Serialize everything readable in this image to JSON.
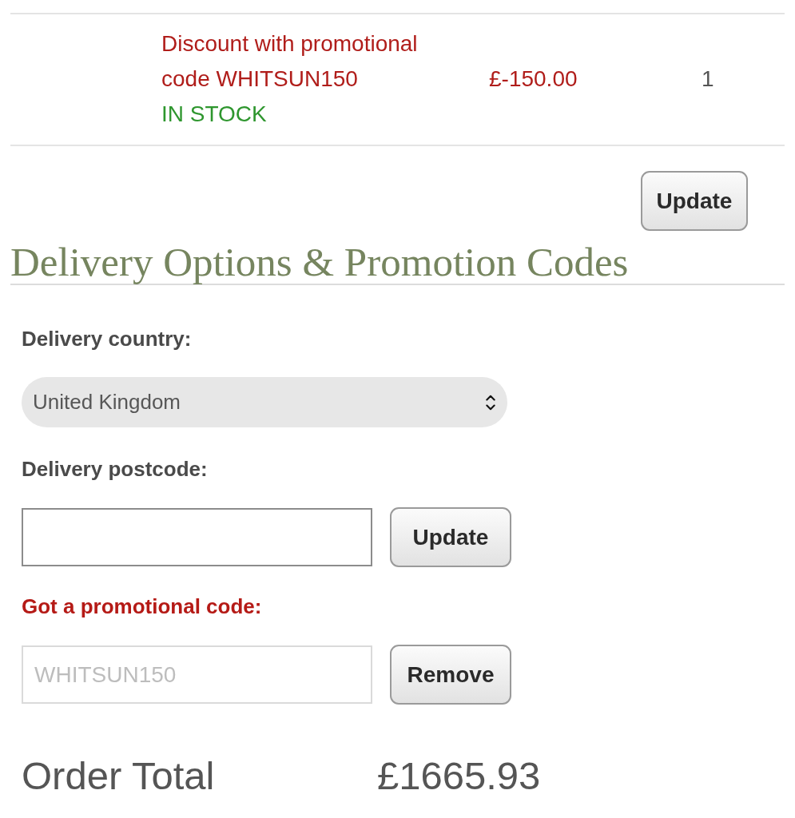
{
  "cart_items": [
    {
      "description": "Discount with promotional code WHITSUN150",
      "stock": "IN STOCK",
      "price": "£-150.00",
      "quantity": "1",
      "discount": true
    }
  ],
  "update_button": "Update",
  "delivery": {
    "title": "Delivery Options & Promotion Codes",
    "fields": [
      {
        "kind": "select",
        "label": "Delivery country:",
        "highlighted": false,
        "value": "United Kingdom"
      },
      {
        "kind": "text",
        "label": "Delivery postcode:",
        "highlighted": false,
        "disabled": false,
        "button": "Update"
      },
      {
        "kind": "text",
        "label": "Got a promotional code:",
        "highlighted": true,
        "disabled": true,
        "value": "WHITSUN150",
        "button": "Remove"
      }
    ]
  },
  "order_total": {
    "label": "Order Total",
    "value": "£1665.93"
  }
}
